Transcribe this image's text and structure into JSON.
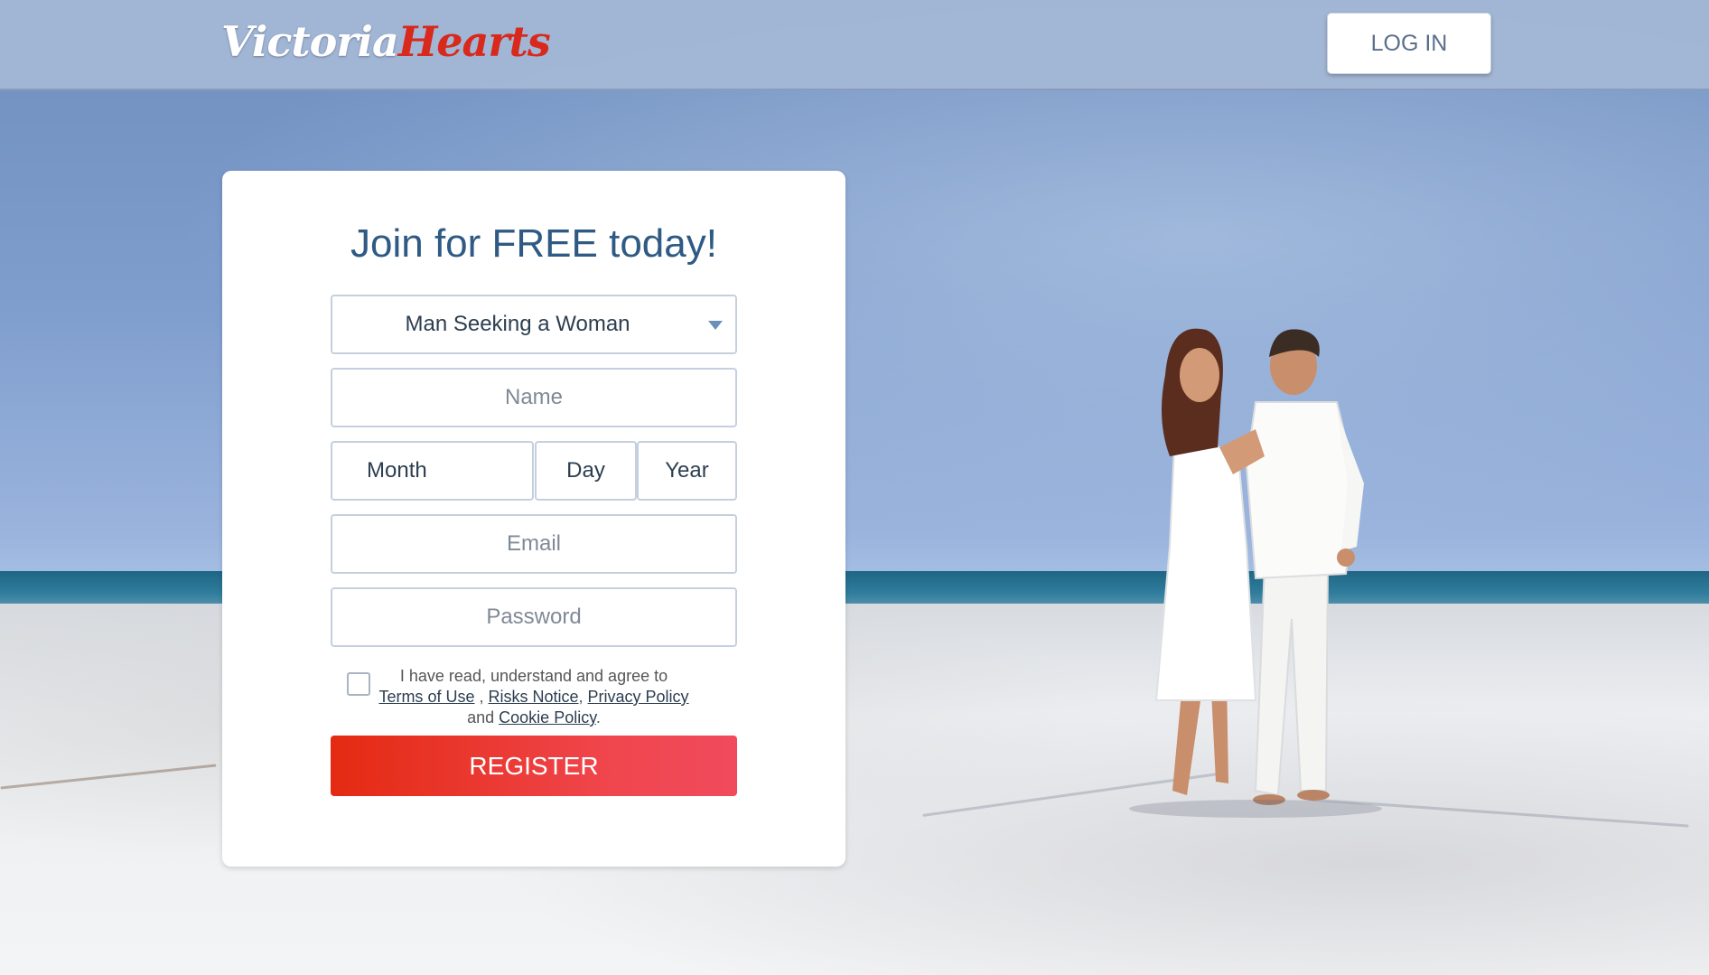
{
  "header": {
    "logo": {
      "part1": "Victoria",
      "part2": "Hearts"
    },
    "login_label": "LOG IN"
  },
  "form": {
    "title": "Join for FREE today!",
    "seeking": {
      "value": "Man Seeking a Woman"
    },
    "name": {
      "placeholder": "Name"
    },
    "birth": {
      "month_label": "Month",
      "day_label": "Day",
      "year_label": "Year"
    },
    "email": {
      "placeholder": "Email"
    },
    "password": {
      "placeholder": "Password"
    },
    "agreement": {
      "checked": false,
      "intro": "I have read, understand and agree to",
      "terms_link": "Terms of Use",
      "risks_link": "Risks Notice",
      "privacy_link": "Privacy Policy",
      "and_text": "and",
      "cookie_link": "Cookie Policy"
    },
    "register_label": "REGISTER"
  },
  "colors": {
    "brand_red": "#d8291c",
    "title_blue": "#2e5a84",
    "register_gradient_start": "#e42a12",
    "register_gradient_end": "#f04a5c"
  },
  "icons": {
    "select_caret": "chevron-down-icon",
    "checkbox": "checkbox-unchecked-icon"
  }
}
